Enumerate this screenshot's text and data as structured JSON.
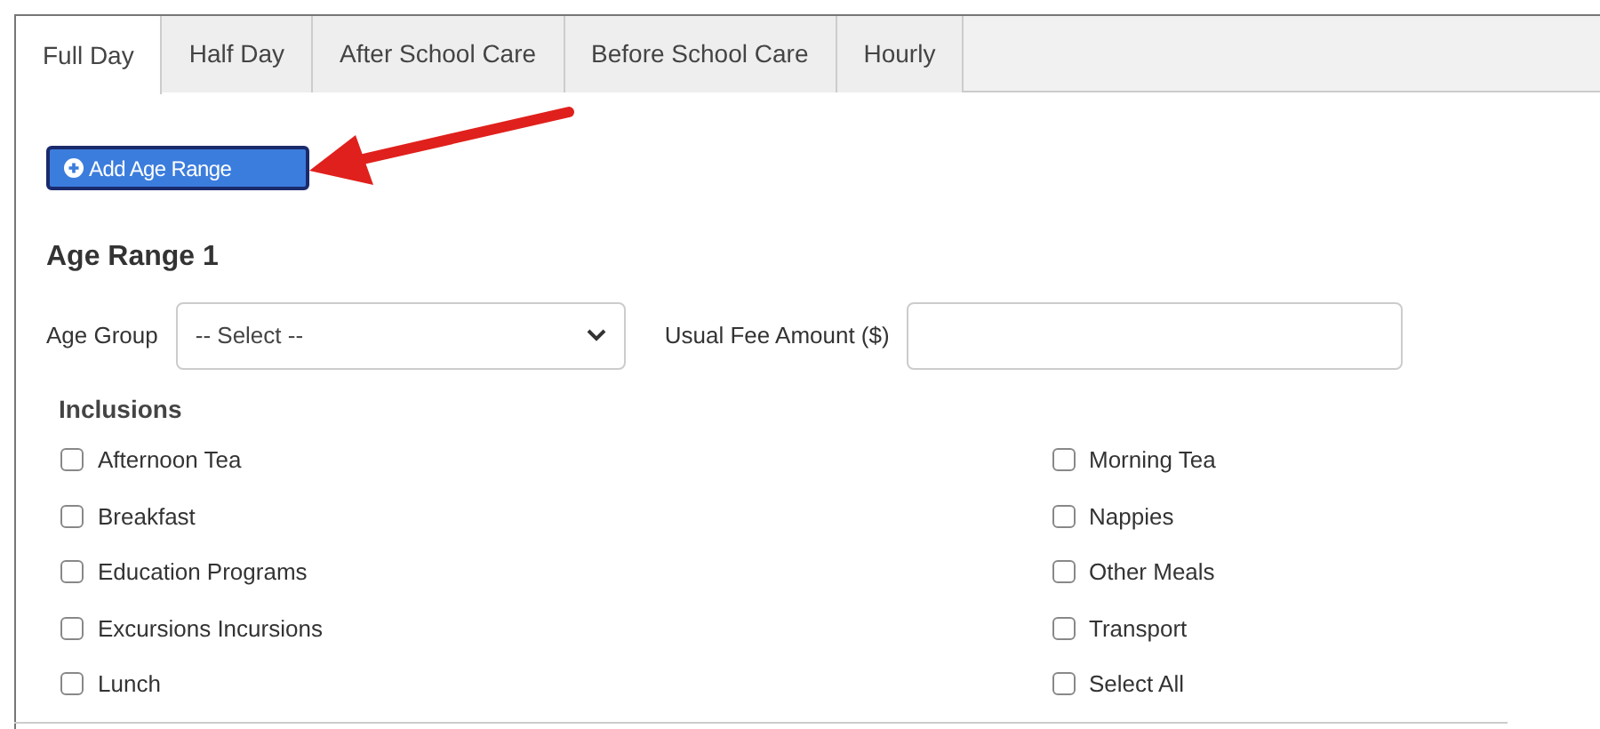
{
  "tabs": [
    {
      "label": "Full Day",
      "selected": true
    },
    {
      "label": "Half Day",
      "selected": false
    },
    {
      "label": "After School Care",
      "selected": false
    },
    {
      "label": "Before School Care",
      "selected": false
    },
    {
      "label": "Hourly",
      "selected": false
    }
  ],
  "add_button": {
    "label": "Add Age Range"
  },
  "age_range": {
    "title": "Age Range 1",
    "age_group": {
      "label": "Age Group",
      "value": "-- Select --"
    },
    "fee": {
      "label": "Usual Fee Amount ($)"
    }
  },
  "inclusions": {
    "title": "Inclusions",
    "items": [
      {
        "label": "Afternoon Tea",
        "checked": false
      },
      {
        "label": "Breakfast",
        "checked": false
      },
      {
        "label": "Education Programs",
        "checked": false
      },
      {
        "label": "Excursions Incursions",
        "checked": false
      },
      {
        "label": "Lunch",
        "checked": false
      },
      {
        "label": "Morning Tea",
        "checked": false
      },
      {
        "label": "Nappies",
        "checked": false
      },
      {
        "label": "Other Meals",
        "checked": false
      },
      {
        "label": "Transport",
        "checked": false
      },
      {
        "label": "Select All",
        "checked": false
      }
    ]
  }
}
